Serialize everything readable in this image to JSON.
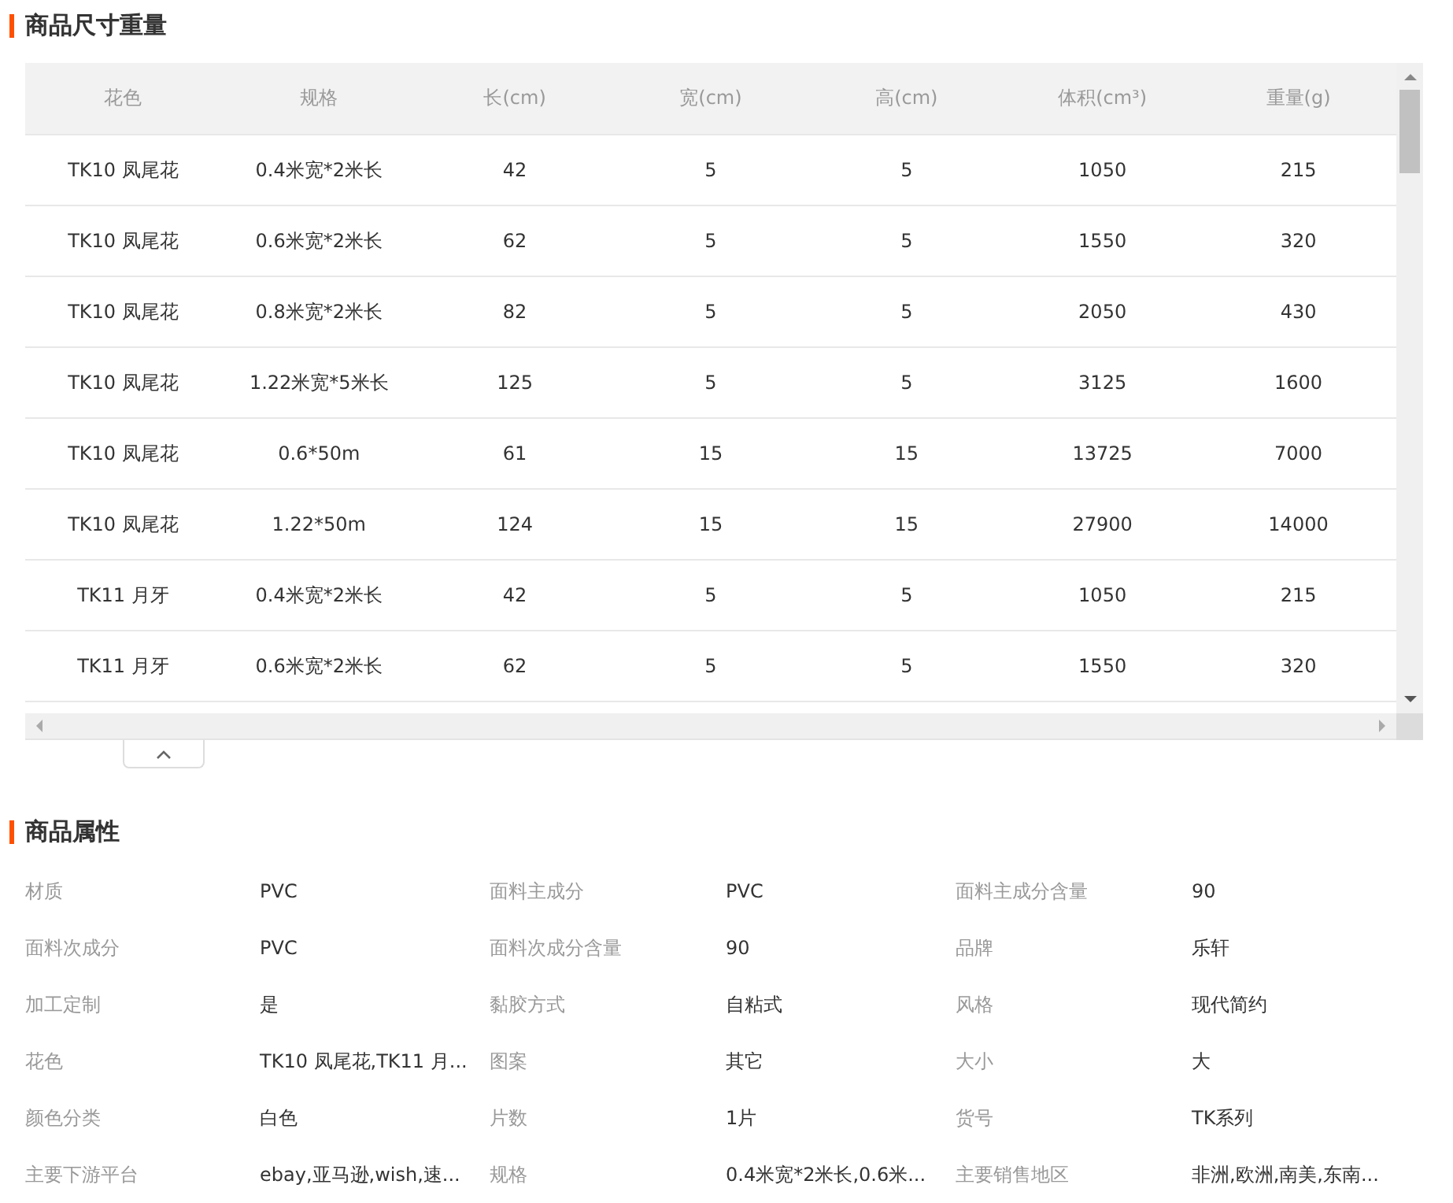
{
  "size_section": {
    "title": "商品尺寸重量",
    "table": {
      "columns": [
        "花色",
        "规格",
        "长(cm)",
        "宽(cm)",
        "高(cm)",
        "体积(cm³)",
        "重量(g)"
      ],
      "rows": [
        [
          "TK10 凤尾花",
          "0.4米宽*2米长",
          "42",
          "5",
          "5",
          "1050",
          "215"
        ],
        [
          "TK10 凤尾花",
          "0.6米宽*2米长",
          "62",
          "5",
          "5",
          "1550",
          "320"
        ],
        [
          "TK10 凤尾花",
          "0.8米宽*2米长",
          "82",
          "5",
          "5",
          "2050",
          "430"
        ],
        [
          "TK10 凤尾花",
          "1.22米宽*5米长",
          "125",
          "5",
          "5",
          "3125",
          "1600"
        ],
        [
          "TK10 凤尾花",
          "0.6*50m",
          "61",
          "15",
          "15",
          "13725",
          "7000"
        ],
        [
          "TK10 凤尾花",
          "1.22*50m",
          "124",
          "15",
          "15",
          "27900",
          "14000"
        ],
        [
          "TK11 月牙",
          "0.4米宽*2米长",
          "42",
          "5",
          "5",
          "1050",
          "215"
        ],
        [
          "TK11 月牙",
          "0.6米宽*2米长",
          "62",
          "5",
          "5",
          "1550",
          "320"
        ]
      ]
    }
  },
  "attr_section": {
    "title": "商品属性",
    "attributes": [
      {
        "label": "材质",
        "value": "PVC"
      },
      {
        "label": "面料主成分",
        "value": "PVC"
      },
      {
        "label": "面料主成分含量",
        "value": "90"
      },
      {
        "label": "面料次成分",
        "value": "PVC"
      },
      {
        "label": "面料次成分含量",
        "value": "90"
      },
      {
        "label": "品牌",
        "value": "乐轩"
      },
      {
        "label": "加工定制",
        "value": "是"
      },
      {
        "label": "黏胶方式",
        "value": "自粘式"
      },
      {
        "label": "风格",
        "value": "现代简约"
      },
      {
        "label": "花色",
        "value": "TK10 凤尾花,TK11 月..."
      },
      {
        "label": "图案",
        "value": "其它"
      },
      {
        "label": "大小",
        "value": "大"
      },
      {
        "label": "颜色分类",
        "value": "白色"
      },
      {
        "label": "片数",
        "value": "1片"
      },
      {
        "label": "货号",
        "value": "TK系列"
      },
      {
        "label": "主要下游平台",
        "value": "ebay,亚马逊,wish,速..."
      },
      {
        "label": "规格",
        "value": "0.4米宽*2米长,0.6米..."
      },
      {
        "label": "主要销售地区",
        "value": "非洲,欧洲,南美,东南..."
      }
    ]
  }
}
